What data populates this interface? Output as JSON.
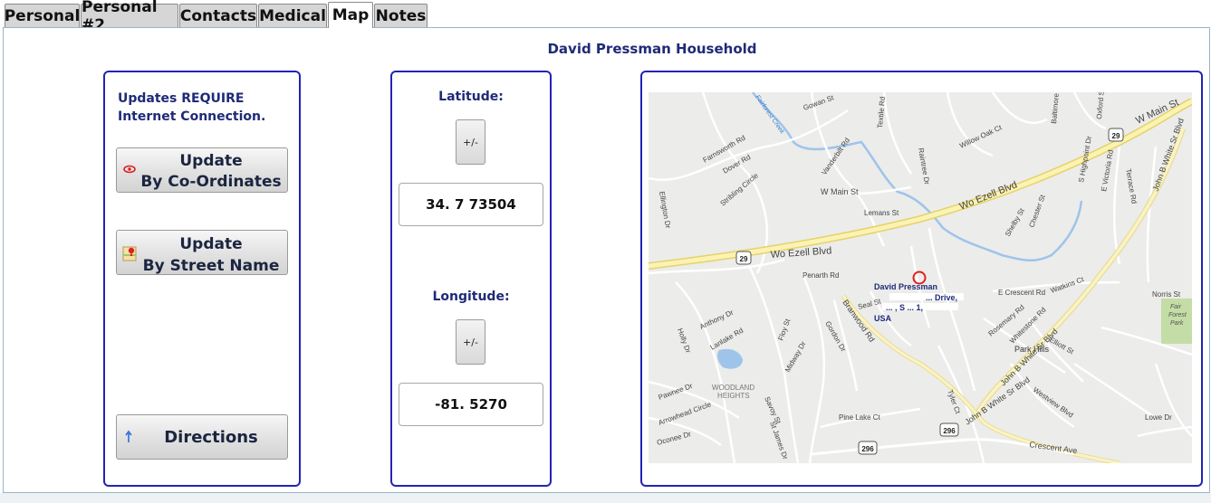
{
  "tabs": [
    {
      "label": "Personal",
      "active": false
    },
    {
      "label": "Personal #2",
      "active": false
    },
    {
      "label": "Contacts",
      "active": false
    },
    {
      "label": "Medical",
      "active": false
    },
    {
      "label": "Map",
      "active": true
    },
    {
      "label": "Notes",
      "active": false
    }
  ],
  "household_title": "David Pressman Household",
  "update_panel": {
    "note": "Updates REQUIRE Internet Connection.",
    "by_coords": {
      "line1": "Update",
      "line2": "By Co-Ordinates",
      "icon": "eye-icon"
    },
    "by_street": {
      "line1": "Update",
      "line2": "By Street Name",
      "icon": "map-pin-icon"
    },
    "directions": {
      "label": "Directions",
      "icon": "route-arrow-icon"
    }
  },
  "coords_panel": {
    "latitude_label": "Latitude:",
    "latitude_toggle": "+/-",
    "latitude_value": "34.  7  73504",
    "longitude_label": "Longitude:",
    "longitude_toggle": "+/-",
    "longitude_value": "-81.      5270"
  },
  "map": {
    "pin_name": "David Pressman",
    "pin_address_line1": "  ...  Drive,",
    "pin_address_line2": "  ...  , S  ...  1,",
    "pin_address_line3": "USA",
    "place_labels": {
      "wo_ezell_1": "Wo Ezell Blvd",
      "wo_ezell_2": "Wo Ezell Blvd",
      "w_main_1": "W Main St",
      "w_main_2": "W Main St",
      "john_b_white_1": "John B White Sr Blvd",
      "john_b_white_2": "John B White Sr Blvd",
      "john_b_white_3": "John B White Sr Blvd",
      "park_hills": "Park Hills",
      "woodland_heights_1": "WOODLAND",
      "woodland_heights_2": "HEIGHTS",
      "fair_forest_park_1": "Fair",
      "fair_forest_park_2": "Forest",
      "fair_forest_park_3": "Park",
      "crescent_ave": "Crescent Ave",
      "e_crescent_rd": "E Crescent Rd",
      "branwood_rd": "Branwood Rd",
      "lemans_st": "Lemans St",
      "penarth_rd": "Penarth Rd",
      "pine_lake_ct": "Pine Lake Ct",
      "arrowhead_circle": "Arrowhead Circle",
      "westview_blvd": "Westview Blvd",
      "farnsworth_rd": "Farnsworth Rd",
      "dover_rd": "Dover Rd",
      "stribling_circle": "Stribling Circle",
      "vanderbilt_rd": "Vanderbilt Rd",
      "willow_oak_ct": "Willow Oak Ct",
      "fairforest_creek": "Fairforest Creek",
      "elliott_st": "Elliott St",
      "lowe_dr": "Lowe Dr",
      "norris_st": "Norris St",
      "oconee_dr": "Oconee Dr",
      "pawnee_dr": "Pawnee Dr",
      "lanlake_rd": "Lanlake Rd",
      "tyler_ct": "Tyler Ct",
      "s_highpoint": "S Highpoint Dr",
      "e_victoria": "E Victoria Rd",
      "terrace_rd": "Terrace Rd",
      "shelby_st": "Shelby St",
      "chester_st": "Chester St",
      "watkins_ct": "Watkins Ct",
      "rosemary_rd": "Rosemary Rd",
      "whitestone_rd": "Whitestone Rd",
      "gordon_dr": "Gordon Dr",
      "midway_dr": "Midway Dr",
      "floy_st": "Floy St",
      "anthony_dr": "Anthony Dr",
      "holly_dr": "Holly Dr",
      "ellington_dr": "Ellington Dr",
      "savoy_st": "Savoy St",
      "st_james_dr": "St James Dr",
      "raintree_dr": "Raintree Dr",
      "textile_rd": "Textile Rd",
      "gowan_st": "Gowan St",
      "oxford_st": "Oxford St",
      "baltimore_st": "Baltimore St",
      "seal_st": "Seal St",
      "route_29a": "29",
      "route_29b": "29",
      "route_296a": "296",
      "route_296b": "296"
    }
  },
  "colors": {
    "accent": "#1f2a78",
    "panel_border": "#2323b5",
    "map_bg": "#ececea",
    "major_road": "#faf3b4",
    "water": "#9ec4ea"
  }
}
